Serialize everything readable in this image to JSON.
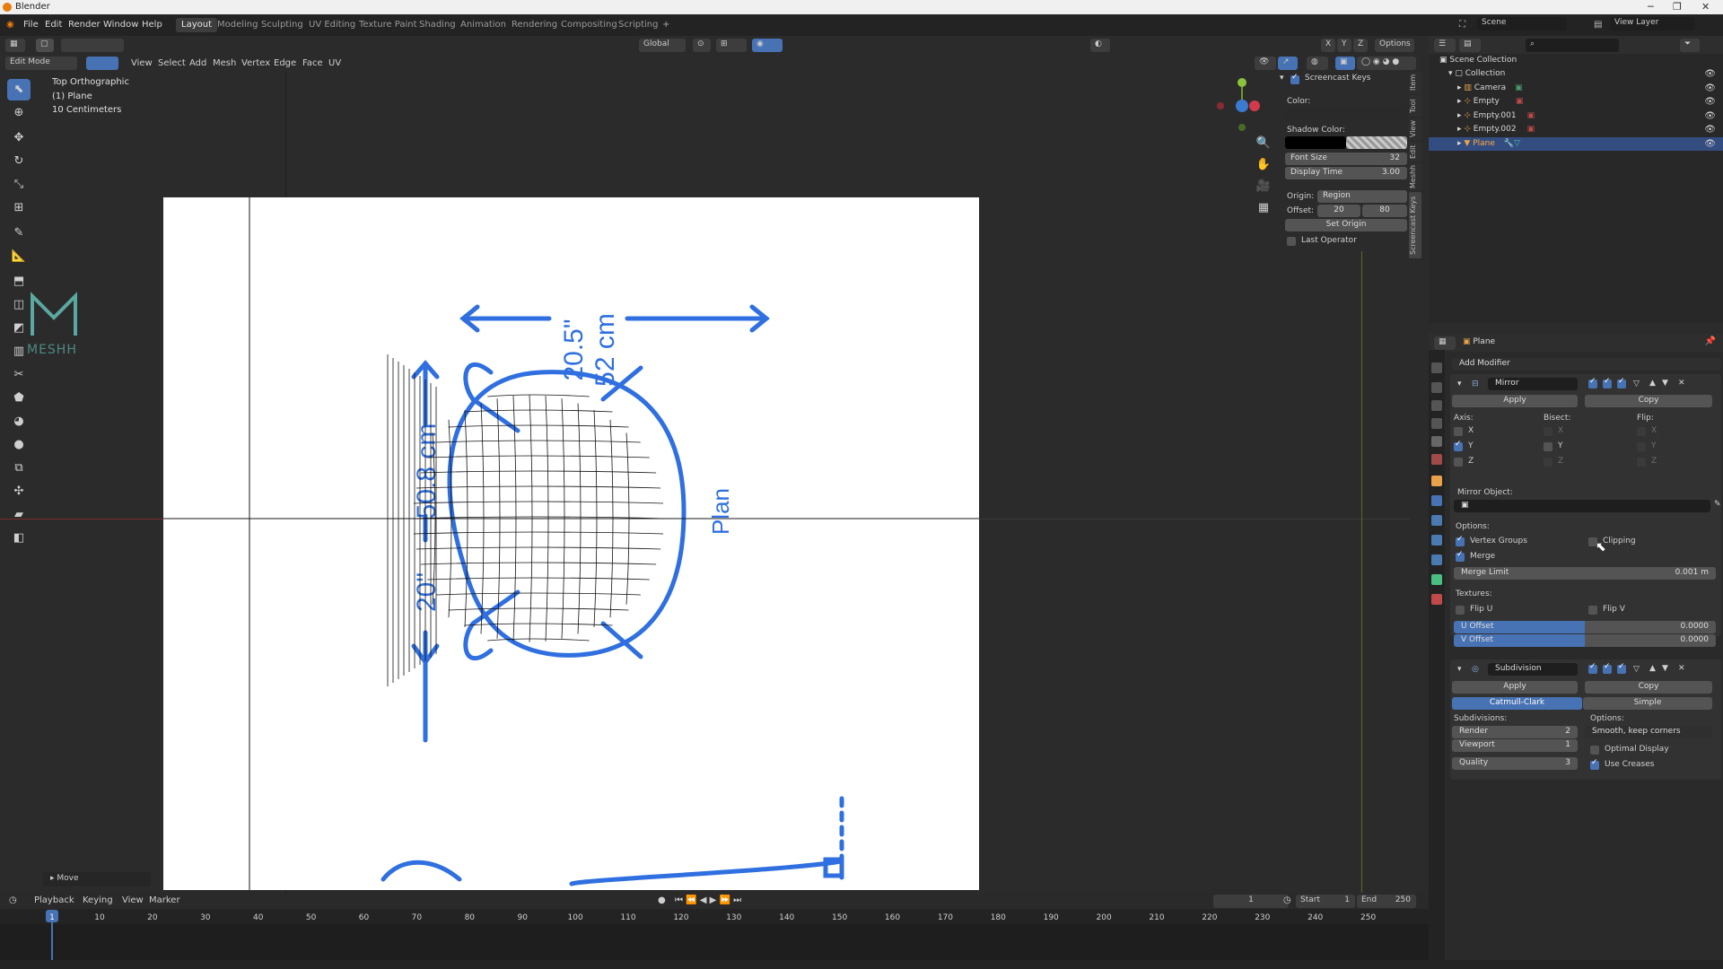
{
  "window": {
    "title": "Blender"
  },
  "menu": [
    "File",
    "Edit",
    "Render",
    "Window",
    "Help"
  ],
  "workspaces": [
    "Layout",
    "Modeling",
    "Sculpting",
    "UV Editing",
    "Texture Paint",
    "Shading",
    "Animation",
    "Rendering",
    "Compositing",
    "Scripting"
  ],
  "active_workspace": "Layout",
  "scene": {
    "label": "Scene",
    "view_layer": "View Layer"
  },
  "viewport_header": {
    "mode": "Edit Mode",
    "menus": [
      "View",
      "Select",
      "Add",
      "Mesh",
      "Vertex",
      "Edge",
      "Face",
      "UV"
    ],
    "orientation": "Global",
    "options": "Options",
    "axes": [
      "X",
      "Y",
      "Z"
    ]
  },
  "viewport_info": {
    "view": "Top Orthographic",
    "object": "(1) Plane",
    "scale": "10 Centimeters"
  },
  "reference_image": {
    "width_in": "20.5\"",
    "width_cm": "52 cm",
    "depth_cm": "50.8 cm",
    "depth_in": "20\"",
    "view_label": "Plan",
    "line_color": "#2f6fe0"
  },
  "watermark": {
    "text": "MESHH"
  },
  "screencast_keys": {
    "title": "Screencast Keys",
    "color_label": "Color:",
    "shadow_label": "Shadow Color:",
    "font_size_label": "Font Size",
    "font_size": "32",
    "display_time_label": "Display Time",
    "display_time": "3.00",
    "origin_label": "Origin:",
    "origin_value": "Region",
    "offset_label": "Offset:",
    "offset_x": "20",
    "offset_y": "80",
    "set_origin": "Set Origin",
    "last_operator": "Last Operator"
  },
  "side_tabs": [
    "Item",
    "Tool",
    "View",
    "Edit",
    "Meshh",
    "Screencast Keys"
  ],
  "outliner": {
    "root": "Scene Collection",
    "collection": "Collection",
    "items": [
      "Camera",
      "Empty",
      "Empty.001",
      "Empty.002",
      "Plane"
    ],
    "selected": "Plane"
  },
  "properties": {
    "object_name": "Plane",
    "add_modifier": "Add Modifier",
    "mirror": {
      "name": "Mirror",
      "apply": "Apply",
      "copy": "Copy",
      "axis_label": "Axis:",
      "bisect_label": "Bisect:",
      "flip_label": "Flip:",
      "axes": [
        "X",
        "Y",
        "Z"
      ],
      "mirror_object_label": "Mirror Object:",
      "options_label": "Options:",
      "vertex_groups": "Vertex Groups",
      "clipping": "Clipping",
      "merge": "Merge",
      "merge_limit_label": "Merge Limit",
      "merge_limit": "0.001 m",
      "textures_label": "Textures:",
      "flip_u": "Flip U",
      "flip_v": "Flip V",
      "u_offset_label": "U Offset",
      "u_offset": "0.0000",
      "v_offset_label": "V Offset",
      "v_offset": "0.0000"
    },
    "subdivision": {
      "name": "Subdivision",
      "apply": "Apply",
      "copy": "Copy",
      "catmull": "Catmull-Clark",
      "simple": "Simple",
      "subdivisions_label": "Subdivisions:",
      "options_label": "Options:",
      "render_label": "Render",
      "render": "2",
      "viewport_label": "Viewport",
      "viewport": "1",
      "quality_label": "Quality",
      "quality": "3",
      "smooth": "Smooth, keep corners",
      "optimal_display": "Optimal Display",
      "use_creases": "Use Creases"
    }
  },
  "last_op": "Move",
  "timeline": {
    "menus": [
      "Playback",
      "Keying",
      "View",
      "Marker"
    ],
    "current_frame": "1",
    "start_label": "Start",
    "start": "1",
    "end_label": "End",
    "end": "250",
    "ticks": [
      "1",
      "10",
      "20",
      "30",
      "40",
      "50",
      "60",
      "70",
      "80",
      "90",
      "100",
      "110",
      "120",
      "130",
      "140",
      "150",
      "160",
      "170",
      "180",
      "190",
      "200",
      "210",
      "220",
      "230",
      "240",
      "250"
    ]
  }
}
